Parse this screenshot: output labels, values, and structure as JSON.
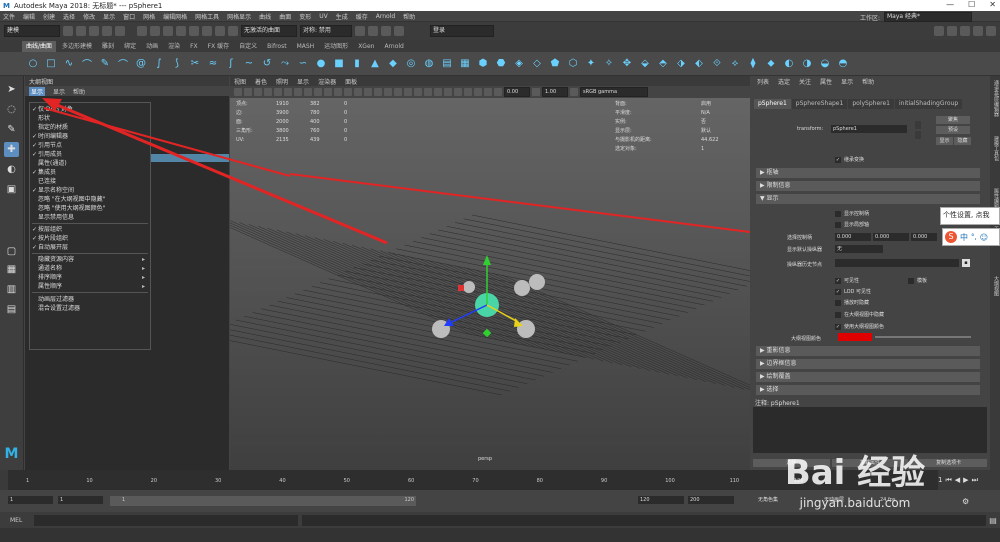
{
  "window": {
    "title": "Autodesk Maya 2018: 无标题*  ---  pSphere1"
  },
  "menubar": {
    "items": [
      "文件",
      "编辑",
      "创建",
      "选择",
      "修改",
      "显示",
      "窗口",
      "网格",
      "编辑网格",
      "网格工具",
      "网格显示",
      "曲线",
      "曲面",
      "变形",
      "UV",
      "生成",
      "缓存",
      "Arnold",
      "帮助"
    ],
    "workspace_label": "工作区:",
    "workspace_value": "Maya 经典*"
  },
  "statusline": {
    "mode": "建模",
    "live_surface": "无激活的曲面",
    "symmetry": "对称: 禁用",
    "login": "登录"
  },
  "shelf": {
    "tabs": [
      "曲线/曲面",
      "多边形建模",
      "雕刻",
      "绑定",
      "动画",
      "渲染",
      "FX",
      "FX 缓存",
      "自定义",
      "Bifrost",
      "MASH",
      "运动图形",
      "XGen",
      "Arnold"
    ],
    "active_tab": 0
  },
  "outliner": {
    "title": "大纲视图",
    "menu": [
      "显示",
      "显示",
      "帮助"
    ],
    "dropdown_items": [
      {
        "label": "仅 DAG 对象",
        "checked": true
      },
      {
        "label": "形状",
        "checked": false
      },
      {
        "label": "指定的材质",
        "checked": false
      },
      {
        "label": "时间编辑器",
        "checked": true
      },
      {
        "label": "引用节点",
        "checked": true
      },
      {
        "label": "引用成员",
        "checked": true
      },
      {
        "label": "属性(通道)",
        "checked": false
      },
      {
        "label": "集成员",
        "checked": true
      },
      {
        "label": "已连接",
        "checked": false
      },
      {
        "label": "显示名称空间",
        "checked": true
      },
      {
        "label": "忽略 \"在大纲视图中隐藏\"",
        "checked": false
      },
      {
        "label": "忽略 \"使用大纲视图颜色\"",
        "checked": false
      },
      {
        "label": "显示禁用信息",
        "checked": false
      },
      {
        "label": "按层组织",
        "checked": true
      },
      {
        "label": "按片段组织",
        "checked": true
      },
      {
        "label": "自动展开层",
        "checked": true
      }
    ],
    "dropdown_submenus": [
      "隐藏资源内容",
      "通道名称",
      "排序顺序",
      "属性顺序",
      "动画层过滤器",
      "混合设置过滤器"
    ]
  },
  "viewport": {
    "menu": [
      "视图",
      "着色",
      "照明",
      "显示",
      "渲染器",
      "面板"
    ],
    "exposure": "0.00",
    "gamma": "1.00",
    "colorspace": "sRGB gamma",
    "hud_left": [
      {
        "label": "顶点:",
        "v1": "1910",
        "v2": "382",
        "v3": "0"
      },
      {
        "label": "边:",
        "v1": "3900",
        "v2": "780",
        "v3": "0"
      },
      {
        "label": "面:",
        "v1": "2000",
        "v2": "400",
        "v3": "0"
      },
      {
        "label": "三角形:",
        "v1": "3800",
        "v2": "760",
        "v3": "0"
      },
      {
        "label": "UV:",
        "v1": "2135",
        "v2": "439",
        "v3": "0"
      }
    ],
    "hud_right": [
      {
        "label": "背面:",
        "value": "启用"
      },
      {
        "label": "平滑度:",
        "value": "N/A"
      },
      {
        "label": "实例:",
        "value": "否"
      },
      {
        "label": "显示层:",
        "value": "默认"
      },
      {
        "label": "与摄影机的距离:",
        "value": "44.622"
      },
      {
        "label": "选定对象:",
        "value": "1"
      }
    ],
    "camera": "persp"
  },
  "attribute_editor": {
    "menu": [
      "列表",
      "选定",
      "关注",
      "属性",
      "显示",
      "帮助"
    ],
    "tabs": [
      "pSphere1",
      "pSphereShape1",
      "polySphere1",
      "initialShadingGroup"
    ],
    "transform_label": "transform:",
    "transform_value": "pSphere1",
    "buttons": [
      "聚焦",
      "预设",
      "显示",
      "隐藏"
    ],
    "inherit_transform": "继承变换",
    "sections_top": [
      "枢轴",
      "限制信息",
      "显示"
    ],
    "display_checks": [
      {
        "label": "显示控制柄",
        "checked": false
      },
      {
        "label": "显示局部轴",
        "checked": false
      }
    ],
    "selection_handle_label": "选择控制柄",
    "selection_handle_values": [
      "0.000",
      "0.000",
      "0.000"
    ],
    "display_manip_label": "显示默认操纵器",
    "display_manip_value": "无",
    "manip_history_label": "操纵器历史节点",
    "visibility_checks": [
      {
        "label": "可见性",
        "checked": true
      },
      {
        "label": "模板",
        "checked": false
      },
      {
        "label": "LOD 可见性",
        "checked": true
      },
      {
        "label": "播放时隐藏",
        "checked": false
      },
      {
        "label": "在大纲视图中隐藏",
        "checked": false
      },
      {
        "label": "使用大纲视图颜色",
        "checked": true
      }
    ],
    "outliner_color_label": "大纲视图颜色",
    "outliner_color": "#e00000",
    "sections_bottom": [
      "重影信息",
      "边界框信息",
      "绘制覆盖",
      "选择"
    ],
    "notes_label": "注释: pSphere1",
    "bottom_buttons": [
      "选择",
      "加载属性",
      "复制选项卡"
    ]
  },
  "sidetabs": [
    "通道盒/层编辑器",
    "建模工具包",
    "属性编辑器",
    "工具设置",
    "大纲视图"
  ],
  "timeline": {
    "ticks": [
      "1",
      "10",
      "20",
      "30",
      "40",
      "50",
      "60",
      "70",
      "80",
      "90",
      "100",
      "110",
      "120"
    ],
    "current_frame": "1"
  },
  "range": {
    "start": "1",
    "range_start": "1",
    "range_slider_left": "1",
    "range_slider_right": "120",
    "range_end": "120",
    "end": "200",
    "char_set": "无角色集",
    "anim_layer": "无动画层",
    "fps": "24 fps"
  },
  "cmdline": {
    "label": "MEL"
  },
  "popup": {
    "tooltip": "个性设置, 点我",
    "ime": [
      "中",
      "°,",
      "☺"
    ]
  },
  "watermark": {
    "brand": "Bai 经验",
    "url": "jingyan.baidu.com"
  }
}
